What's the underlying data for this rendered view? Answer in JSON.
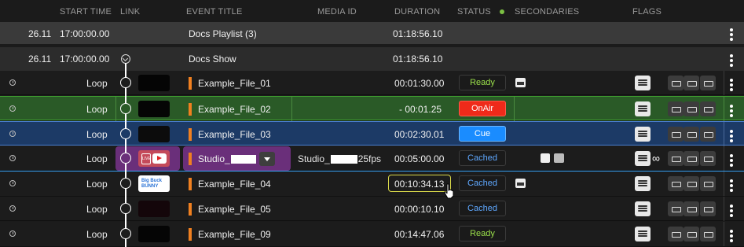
{
  "header": {
    "start_time": "START TIME",
    "link": "LINK",
    "event_title": "EVENT TITLE",
    "media_id": "MEDIA ID",
    "duration": "DURATION",
    "status": "STATUS",
    "secondaries": "SECONDARIES",
    "flags": "FLAGS",
    "status_dot_color": "#7cc043"
  },
  "groups": [
    {
      "date": "26.11",
      "time": "17:00:00.00",
      "title": "Docs Playlist (3)",
      "duration": "01:18:56.10"
    },
    {
      "date": "26.11",
      "time": "17:00:00.00",
      "title": "Docs Show",
      "duration": "01:18:56.10"
    }
  ],
  "items": [
    {
      "mode": "Loop",
      "title": "Example_File_01",
      "duration": "00:01:30.00",
      "status": "Ready"
    },
    {
      "mode": "Loop",
      "title": "Example_File_02",
      "duration": "- 00:01.25",
      "status": "OnAir"
    },
    {
      "mode": "Loop",
      "title": "Example_File_03",
      "duration": "00:02:30.01",
      "status": "Cue"
    },
    {
      "mode": "Loop",
      "title": "Studio_",
      "media_id": "Studio_",
      "media_id_suffix": "25fps",
      "duration": "00:05:00.00",
      "status": "Cached",
      "thumb_label": "LIVE"
    },
    {
      "mode": "Loop",
      "title": "Example_File_04",
      "duration": "00:10:34.13",
      "status": "Cached",
      "thumb_label": "Big Buck BUNNY"
    },
    {
      "mode": "Loop",
      "title": "Example_File_05",
      "duration": "00:00:10.10",
      "status": "Cached"
    },
    {
      "mode": "Loop",
      "title": "Example_File_09",
      "duration": "00:14:47.06",
      "status": "Ready"
    }
  ],
  "colors": {
    "onair_row": "#2a5a27",
    "cue_row": "#1c3a66",
    "ready_text": "#9be04b",
    "cached_text": "#5fa8ff",
    "onair_badge": "#ef2a1a",
    "cue_badge": "#1a8cff",
    "accent_bar": "#f08020"
  }
}
